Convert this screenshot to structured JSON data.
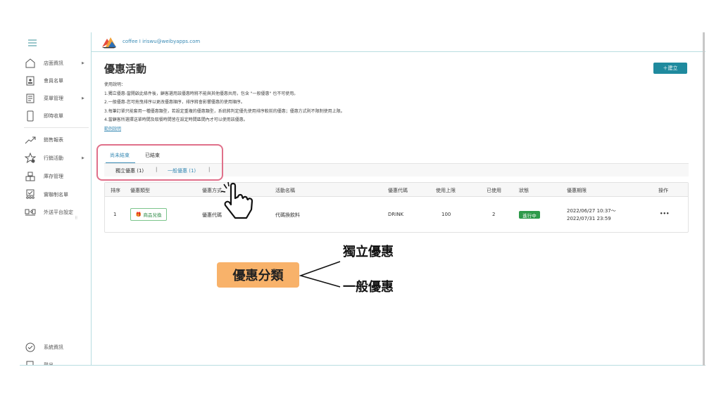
{
  "sidebar": {
    "items": [
      {
        "label": "店面資訊",
        "icon": "store-icon",
        "arrow": true
      },
      {
        "label": "會員名單",
        "icon": "member-card-icon",
        "arrow": false
      },
      {
        "label": "菜單管理",
        "icon": "menu-book-icon",
        "arrow": true
      },
      {
        "label": "即時收單",
        "icon": "tablet-icon",
        "arrow": false
      },
      {
        "label": "銷售報表",
        "icon": "trend-chart-icon",
        "arrow": false
      },
      {
        "label": "行銷活動",
        "icon": "star-gear-icon",
        "arrow": true
      },
      {
        "label": "庫存管理",
        "icon": "inventory-icon",
        "arrow": false
      },
      {
        "label": "實聯制名單",
        "icon": "contact-list-icon",
        "arrow": false
      },
      {
        "label": "外送平台設定",
        "icon": "delivery-icon",
        "arrow": false
      },
      {
        "label": "系統資訊",
        "icon": "shield-check-icon",
        "arrow": false
      },
      {
        "label": "登出",
        "icon": "logout-icon",
        "arrow": false
      }
    ]
  },
  "topbar": {
    "account": "coffee I  iriswu@weibyapps.com"
  },
  "page": {
    "title": "優惠活動",
    "create_label": "＋建立"
  },
  "instructions": {
    "heading": "使用說明：",
    "lines": [
      "1.獨立優惠-當開啟此條件後，顧客選用該優惠時將不能與其他優惠共用，包含 \"一般優惠\" 也不可使用。",
      "2.一般優惠-您可拖曳排序以更改優惠順序，排序將會影響優惠的使用順序。",
      "3.每筆訂單只能套用一種優惠類型，若設定重複的優惠類型，系統將判定優先使用排序較前的優惠；優惠方式則不限制使用上限。",
      "4.當顧客所選擇送單時間及取餐時間皆在設定時間區間內才可以使用該優惠。"
    ],
    "example_link": "範例說明"
  },
  "tabs": {
    "active": "尚未結束",
    "ended": "已結束"
  },
  "subtabs": {
    "exclusive": "獨立優惠 (1)",
    "general": "一般優惠 (1)",
    "separator": "|"
  },
  "table": {
    "headers": [
      "排序",
      "優惠類型",
      "優惠方式",
      "活動名稱",
      "優惠代碼",
      "使用上限",
      "已使用",
      "狀態",
      "優惠期限",
      "操作"
    ],
    "rows": [
      {
        "order": "1",
        "type": "商品兌換",
        "method": "優惠代碼",
        "name": "代碼換飲料",
        "code": "DRINK",
        "limit": "100",
        "used": "2",
        "status": "進行中",
        "period_start": "2022/06/27 10:37～",
        "period_end": "2022/07/31 23:59",
        "actions": "•••"
      }
    ]
  },
  "annotation": {
    "label": "優惠分類",
    "top": "獨立優惠",
    "bottom": "一般優惠"
  },
  "colors": {
    "accent": "#1f8a9e",
    "link": "#3a8bb5",
    "status_green": "#2e9a4a",
    "highlight_pink": "#e0708a",
    "annotation_orange": "#f8b26a"
  }
}
